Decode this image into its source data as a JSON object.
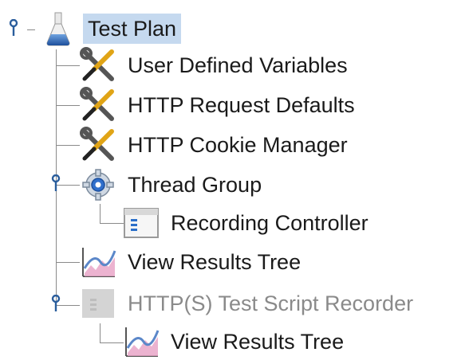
{
  "tree": {
    "root": {
      "label": "Test Plan",
      "icon": "flask-icon",
      "expanded": true,
      "selected": true
    },
    "children": [
      {
        "label": "User Defined Variables",
        "icon": "wrench-screwdriver-icon"
      },
      {
        "label": "HTTP Request Defaults",
        "icon": "wrench-screwdriver-icon"
      },
      {
        "label": "HTTP Cookie Manager",
        "icon": "wrench-screwdriver-icon"
      },
      {
        "label": "Thread Group",
        "icon": "gear-icon",
        "expanded": true,
        "children": [
          {
            "label": "Recording Controller",
            "icon": "controller-icon"
          }
        ]
      },
      {
        "label": "View Results Tree",
        "icon": "graph-icon"
      },
      {
        "label": "HTTP(S) Test Script Recorder",
        "icon": "recorder-icon",
        "expanded": true,
        "disabled": true,
        "children": [
          {
            "label": "View Results Tree",
            "icon": "graph-icon"
          }
        ]
      }
    ]
  },
  "colors": {
    "selection": "#c5d9ef",
    "toggle": "#2a5d9c",
    "connector": "#8a8a8a",
    "disabled_text": "#8a8a8a"
  }
}
